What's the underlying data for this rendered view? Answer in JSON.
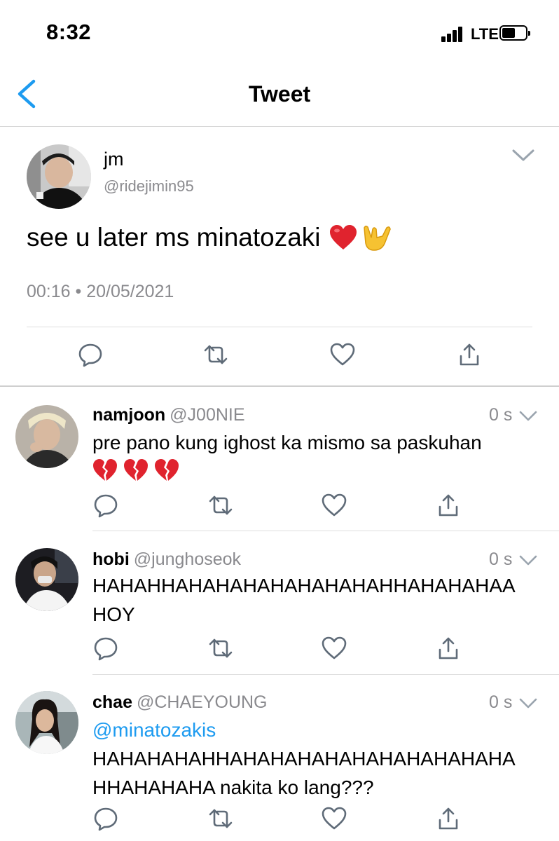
{
  "status_bar": {
    "time": "8:32",
    "network": "LTE"
  },
  "nav": {
    "title": "Tweet"
  },
  "tweet": {
    "name": "jm",
    "handle": "@ridejimin95",
    "text": "see u later ms minatozaki",
    "emojis": [
      "heart-emoji",
      "love-you-gesture-emoji"
    ],
    "timestamp": "00:16 • 20/05/2021"
  },
  "replies": [
    {
      "name": "namjoon",
      "handle": "@J00NIE",
      "ago": "0 s",
      "text": "pre pano kung ighost ka mismo sa paskuhan",
      "emojis": [
        "broken-heart-emoji",
        "broken-heart-emoji",
        "broken-heart-emoji"
      ]
    },
    {
      "name": "hobi",
      "handle": "@junghoseok",
      "ago": "0 s",
      "text": "HAHAHHAHAHAHAHAHAHAHAHHAHAHAHAA HOY"
    },
    {
      "name": "chae",
      "handle": "@CHAEYOUNG",
      "ago": "0 s",
      "mention": "@minatozakis",
      "text": "HAHAHAHAHHAHAHAHAHAHAHAHAHAHAHA HHAHAHAHA nakita ko lang???"
    }
  ],
  "colors": {
    "accent": "#1d9bf0",
    "secondary_text": "#8a8a8e",
    "icon": "#5f6b78"
  }
}
